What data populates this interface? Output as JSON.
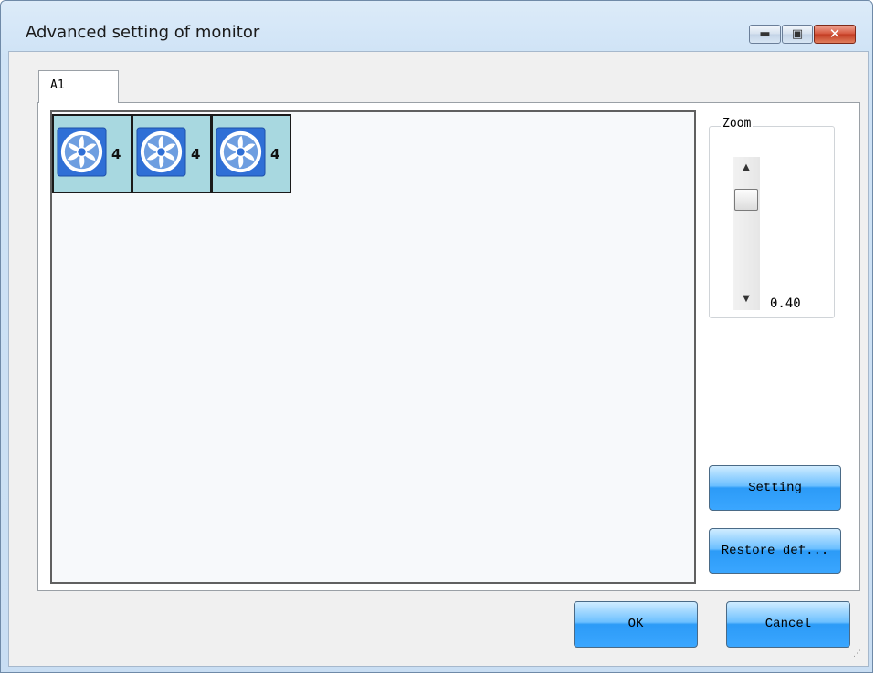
{
  "window": {
    "title": "Advanced setting of monitor",
    "minimize_glyph": "▬",
    "maximize_glyph": "▣",
    "close_glyph": "✕"
  },
  "tabs": [
    {
      "label": "A1",
      "selected": true
    }
  ],
  "canvas": {
    "fans": [
      {
        "icon": "fan-icon",
        "count": "4"
      },
      {
        "icon": "fan-icon",
        "count": "4"
      },
      {
        "icon": "fan-icon",
        "count": "4"
      }
    ]
  },
  "zoom": {
    "label": "Zoom",
    "value": "0.40",
    "up_glyph": "▲",
    "down_glyph": "▼"
  },
  "buttons": {
    "setting": "Setting",
    "restore": "Restore def...",
    "ok": "OK",
    "cancel": "Cancel"
  },
  "colors": {
    "tile_bg": "#a8d8e0",
    "button_blue": "#2c9bf7",
    "close_red": "#c23b22"
  }
}
